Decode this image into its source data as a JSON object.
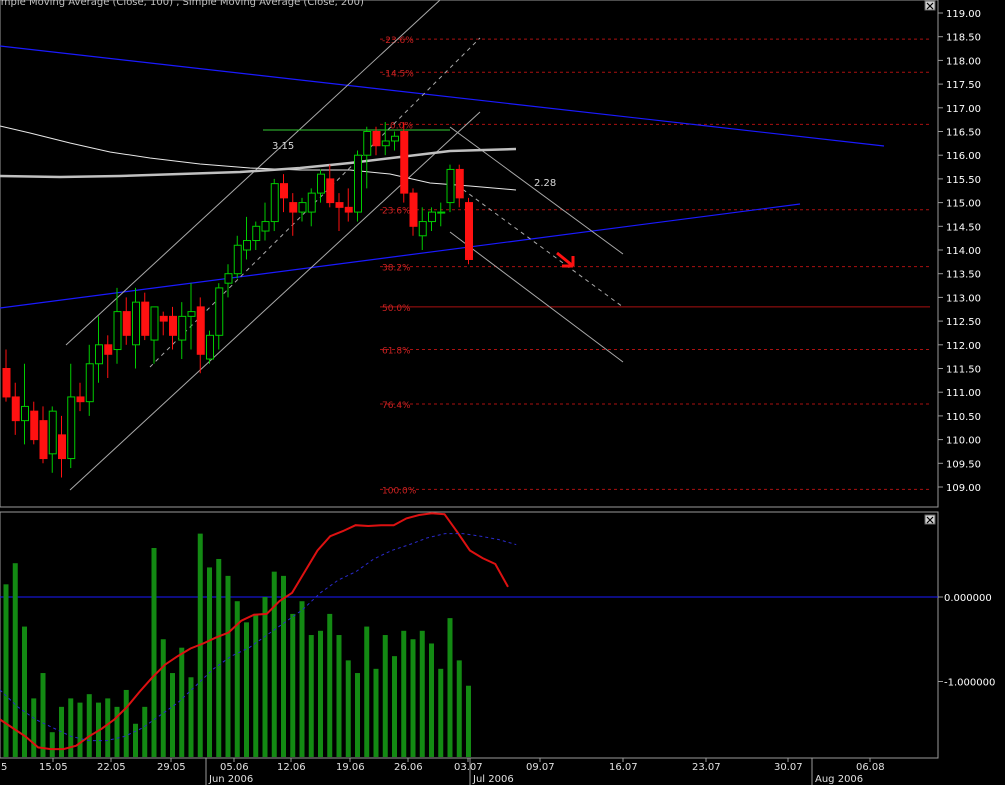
{
  "header": {
    "indicators_label": "imple Moving Average (Close, 100) , Simple Moving Average (Close, 200)"
  },
  "annotations": {
    "range_left": "3.15",
    "range_right": "2.28"
  },
  "price_axis": {
    "labels": [
      "119.00",
      "118.50",
      "118.00",
      "117.50",
      "117.00",
      "116.50",
      "116.00",
      "115.50",
      "115.00",
      "114.50",
      "114.00",
      "113.50",
      "113.00",
      "112.50",
      "112.00",
      "111.50",
      "111.00",
      "110.50",
      "110.00",
      "109.50",
      "109.00"
    ]
  },
  "indicator_axis": {
    "labels": [
      "0.000000",
      "-1.000000"
    ]
  },
  "time_axis": {
    "ticks": [
      "15.05",
      "22.05",
      "29.05",
      "05.06",
      "12.06",
      "19.06",
      "26.06",
      "03.07",
      "09.07",
      "16.07",
      "23.07",
      "30.07",
      "06.08"
    ],
    "months": [
      "Jun 2006",
      "Jul 2006",
      "Aug 2006"
    ],
    "left_partial": "5"
  },
  "colors": {
    "up": "#00cc00",
    "down": "#ff1111",
    "trend": "#1a1aff",
    "fib": "#aa1111",
    "sma": "#c0c0c0",
    "histogram": "#138a13",
    "signal": "#dd1111"
  },
  "chart_data": [
    {
      "type": "candlestick",
      "title": "",
      "ylim": [
        108.8,
        119.2
      ],
      "candles": [
        {
          "o": 111.5,
          "h": 111.9,
          "l": 110.8,
          "c": 110.9
        },
        {
          "o": 110.9,
          "h": 111.2,
          "l": 110.1,
          "c": 110.4
        },
        {
          "o": 110.4,
          "h": 111.6,
          "l": 109.9,
          "c": 110.7
        },
        {
          "o": 110.6,
          "h": 110.8,
          "l": 109.9,
          "c": 110.0
        },
        {
          "o": 110.4,
          "h": 110.7,
          "l": 109.5,
          "c": 109.6
        },
        {
          "o": 109.7,
          "h": 110.7,
          "l": 109.3,
          "c": 110.6
        },
        {
          "o": 110.1,
          "h": 110.5,
          "l": 109.2,
          "c": 109.6
        },
        {
          "o": 109.6,
          "h": 111.6,
          "l": 109.4,
          "c": 110.9
        },
        {
          "o": 110.9,
          "h": 111.2,
          "l": 110.6,
          "c": 110.8
        },
        {
          "o": 110.8,
          "h": 112.0,
          "l": 110.5,
          "c": 111.6
        },
        {
          "o": 111.6,
          "h": 112.6,
          "l": 111.2,
          "c": 112.0
        },
        {
          "o": 112.0,
          "h": 112.2,
          "l": 111.3,
          "c": 111.8
        },
        {
          "o": 111.9,
          "h": 113.2,
          "l": 111.6,
          "c": 112.7
        },
        {
          "o": 112.7,
          "h": 113.0,
          "l": 112.0,
          "c": 112.2
        },
        {
          "o": 112.0,
          "h": 113.2,
          "l": 111.5,
          "c": 112.9
        },
        {
          "o": 112.9,
          "h": 113.1,
          "l": 112.1,
          "c": 112.2
        },
        {
          "o": 112.1,
          "h": 112.7,
          "l": 111.6,
          "c": 112.8
        },
        {
          "o": 112.6,
          "h": 112.7,
          "l": 112.2,
          "c": 112.5
        },
        {
          "o": 112.6,
          "h": 112.8,
          "l": 111.9,
          "c": 112.2
        },
        {
          "o": 112.1,
          "h": 112.9,
          "l": 111.7,
          "c": 112.6
        },
        {
          "o": 112.6,
          "h": 113.3,
          "l": 111.9,
          "c": 112.7
        },
        {
          "o": 112.8,
          "h": 113.0,
          "l": 111.4,
          "c": 111.8
        },
        {
          "o": 111.7,
          "h": 112.3,
          "l": 111.6,
          "c": 112.2
        },
        {
          "o": 112.2,
          "h": 113.3,
          "l": 111.9,
          "c": 113.2
        },
        {
          "o": 113.3,
          "h": 113.7,
          "l": 113.0,
          "c": 113.5
        },
        {
          "o": 113.5,
          "h": 114.3,
          "l": 113.4,
          "c": 114.1
        },
        {
          "o": 114.0,
          "h": 114.7,
          "l": 113.8,
          "c": 114.2
        },
        {
          "o": 114.2,
          "h": 114.6,
          "l": 114.0,
          "c": 114.5
        },
        {
          "o": 114.4,
          "h": 115.0,
          "l": 114.2,
          "c": 114.6
        },
        {
          "o": 114.6,
          "h": 115.5,
          "l": 114.4,
          "c": 115.4
        },
        {
          "o": 115.4,
          "h": 115.6,
          "l": 114.8,
          "c": 115.1
        },
        {
          "o": 115.0,
          "h": 115.2,
          "l": 114.3,
          "c": 114.8
        },
        {
          "o": 114.8,
          "h": 115.1,
          "l": 114.6,
          "c": 115.0
        },
        {
          "o": 114.8,
          "h": 115.3,
          "l": 114.5,
          "c": 115.2
        },
        {
          "o": 115.2,
          "h": 115.7,
          "l": 115.0,
          "c": 115.6
        },
        {
          "o": 115.5,
          "h": 115.8,
          "l": 114.9,
          "c": 115.0
        },
        {
          "o": 115.0,
          "h": 115.2,
          "l": 114.4,
          "c": 114.9
        },
        {
          "o": 114.9,
          "h": 115.3,
          "l": 114.6,
          "c": 114.8
        },
        {
          "o": 114.8,
          "h": 116.1,
          "l": 114.6,
          "c": 116.0
        },
        {
          "o": 116.0,
          "h": 116.6,
          "l": 115.3,
          "c": 116.5
        },
        {
          "o": 116.5,
          "h": 116.6,
          "l": 116.0,
          "c": 116.2
        },
        {
          "o": 116.2,
          "h": 116.7,
          "l": 116.0,
          "c": 116.3
        },
        {
          "o": 116.3,
          "h": 116.5,
          "l": 116.1,
          "c": 116.4
        },
        {
          "o": 116.5,
          "h": 116.7,
          "l": 115.0,
          "c": 115.2
        },
        {
          "o": 115.2,
          "h": 115.3,
          "l": 114.3,
          "c": 114.5
        },
        {
          "o": 114.3,
          "h": 114.9,
          "l": 114.0,
          "c": 114.6
        },
        {
          "o": 114.6,
          "h": 114.9,
          "l": 114.4,
          "c": 114.8
        },
        {
          "o": 114.8,
          "h": 115.0,
          "l": 114.5,
          "c": 114.8
        },
        {
          "o": 115.0,
          "h": 115.8,
          "l": 114.8,
          "c": 115.7
        },
        {
          "o": 115.7,
          "h": 115.8,
          "l": 114.9,
          "c": 115.1
        },
        {
          "o": 115.0,
          "h": 115.1,
          "l": 113.7,
          "c": 113.8
        }
      ],
      "fibonacci": [
        {
          "label": "-23.6%",
          "price": 118.45
        },
        {
          "label": "-14.5%",
          "price": 117.75
        },
        {
          "label": "0.0%",
          "price": 116.65
        },
        {
          "label": "23.6%",
          "price": 114.85
        },
        {
          "label": "38.2%",
          "price": 113.65
        },
        {
          "label": "50.0%",
          "price": 112.8
        },
        {
          "label": "61.8%",
          "price": 111.9
        },
        {
          "label": "76.4%",
          "price": 110.75
        },
        {
          "label": "100.0%",
          "price": 108.95
        }
      ]
    },
    {
      "type": "bar",
      "title": "",
      "ylim": [
        -1.95,
        0.95
      ],
      "histogram": [
        0.15,
        0.4,
        -0.35,
        -1.2,
        -0.9,
        -1.6,
        -1.3,
        -1.2,
        -1.25,
        -1.15,
        -1.25,
        -1.2,
        -1.3,
        -1.1,
        -1.5,
        -1.3,
        0.58,
        -0.5,
        -0.9,
        -0.6,
        -0.95,
        0.75,
        0.35,
        0.45,
        0.25,
        -0.05,
        -0.3,
        -0.2,
        0.0,
        0.3,
        0.25,
        -0.2,
        -0.05,
        -0.45,
        -0.4,
        -0.2,
        -0.45,
        -0.75,
        -0.9,
        -0.35,
        -0.85,
        -0.45,
        -0.7,
        -0.4,
        -0.5,
        -0.4,
        -0.55,
        -0.85,
        -0.25,
        -0.75,
        -1.05
      ],
      "signal": [
        -1.45,
        -1.55,
        -1.65,
        -1.78,
        -1.8,
        -1.8,
        -1.76,
        -1.65,
        -1.56,
        -1.45,
        -1.3,
        -1.12,
        -0.95,
        -0.8,
        -0.7,
        -0.61,
        -0.55,
        -0.48,
        -0.42,
        -0.28,
        -0.21,
        -0.2,
        -0.05,
        0.05,
        0.3,
        0.55,
        0.72,
        0.78,
        0.85,
        0.84,
        0.85,
        0.85,
        0.93,
        0.97,
        0.99,
        0.98,
        0.77,
        0.55,
        0.46,
        0.39,
        0.12
      ],
      "average": [
        -1.1,
        -1.3,
        -1.45,
        -1.55,
        -1.65,
        -1.7,
        -1.7,
        -1.65,
        -1.55,
        -1.4,
        -1.25,
        -1.05,
        -0.85,
        -0.7,
        -0.6,
        -0.45,
        -0.3,
        -0.15,
        0.05,
        0.2,
        0.3,
        0.45,
        0.55,
        0.62,
        0.7,
        0.75,
        0.75,
        0.72,
        0.68,
        0.62
      ]
    }
  ]
}
